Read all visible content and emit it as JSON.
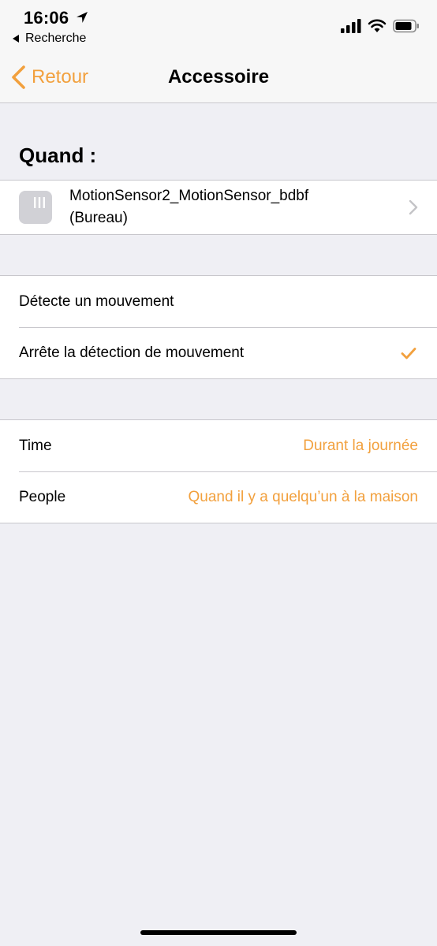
{
  "status_bar": {
    "time": "16:06",
    "back_app_label": "Recherche",
    "icons": [
      "location-arrow-icon",
      "signal-icon",
      "wifi-icon",
      "battery-icon"
    ]
  },
  "nav": {
    "back_label": "Retour",
    "title": "Accessoire"
  },
  "when": {
    "header": "Quand :",
    "accessory": {
      "name_line1": "MotionSensor2_MotionSensor_bdbf",
      "name_line2": "(Bureau)"
    }
  },
  "trigger_options": [
    {
      "label": "Détecte un mouvement",
      "selected": false
    },
    {
      "label": "Arrête la détection de mouvement",
      "selected": true
    }
  ],
  "conditions": [
    {
      "label": "Time",
      "value": "Durant la journée"
    },
    {
      "label": "People",
      "value": "Quand il y a quelqu’un à la maison"
    }
  ],
  "colors": {
    "accent": "#f2a03d",
    "background": "#efeff4",
    "separator": "#c8c7cc"
  }
}
